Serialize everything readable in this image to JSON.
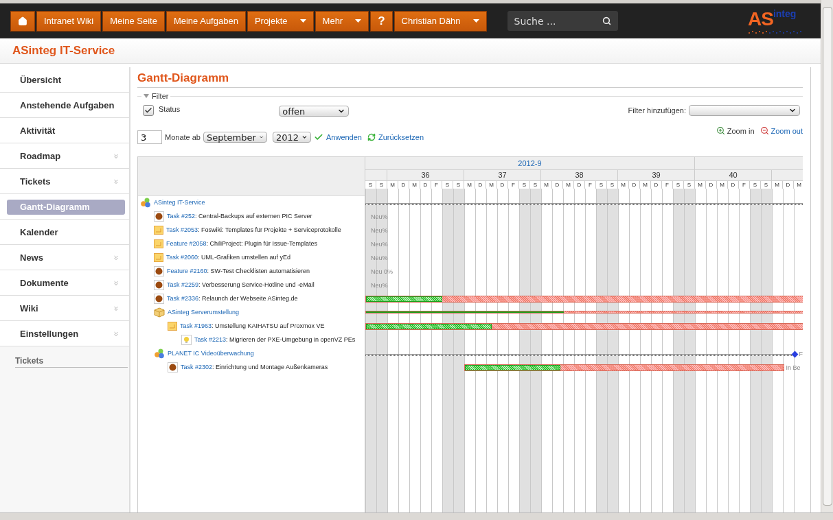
{
  "top_menu": [
    {
      "kind": "home"
    },
    {
      "kind": "item",
      "label": "Intranet Wiki",
      "dropdown": false
    },
    {
      "kind": "item",
      "label": "Meine Seite",
      "dropdown": false
    },
    {
      "kind": "item",
      "label": "Meine Aufgaben",
      "dropdown": false
    },
    {
      "kind": "item",
      "label": "Projekte",
      "dropdown": true
    },
    {
      "kind": "item",
      "label": "Mehr",
      "dropdown": true
    },
    {
      "kind": "help",
      "label": "?",
      "dropdown": false
    },
    {
      "kind": "item",
      "label": "Christian Dähn",
      "dropdown": true
    }
  ],
  "search": {
    "placeholder": "Suche ..."
  },
  "logo": {
    "main": "AS",
    "sup": "integ"
  },
  "project_title": "ASinteg IT-Service",
  "sidebar": {
    "items": [
      {
        "label": "Übersicht",
        "expandable": false,
        "selected": false
      },
      {
        "label": "Anstehende Aufgaben",
        "expandable": false,
        "selected": false
      },
      {
        "label": "Aktivität",
        "expandable": false,
        "selected": false
      },
      {
        "label": "Roadmap",
        "expandable": true,
        "selected": false
      },
      {
        "label": "Tickets",
        "expandable": true,
        "selected": false
      },
      {
        "label": "Gantt-Diagramm",
        "expandable": false,
        "selected": true
      },
      {
        "label": "Kalender",
        "expandable": false,
        "selected": false
      },
      {
        "label": "News",
        "expandable": true,
        "selected": false
      },
      {
        "label": "Dokumente",
        "expandable": true,
        "selected": false
      },
      {
        "label": "Wiki",
        "expandable": true,
        "selected": false
      },
      {
        "label": "Einstellungen",
        "expandable": true,
        "selected": false
      }
    ],
    "section_title": "Tickets"
  },
  "page_title": "Gantt-Diagramm",
  "filter": {
    "legend": "Filter",
    "expanded": true,
    "status": {
      "label": "Status",
      "checked": true,
      "value": "offen"
    },
    "add_label": "Filter hinzufügen:"
  },
  "options": {
    "months": "3",
    "months_label": "Monate ab",
    "month": "September",
    "year": "2012",
    "apply": "Anwenden",
    "reset": "Zurücksetzen",
    "zoom_in": {
      "label": "Zoom in",
      "disabled": true
    },
    "zoom_out": {
      "label": "Zoom out",
      "disabled": false
    }
  },
  "gantt": {
    "months": [
      "2012-9"
    ],
    "lead_days": [
      {
        "label": "S",
        "weekend": true
      },
      {
        "label": "S",
        "weekend": true
      }
    ],
    "weeks": [
      {
        "label": "36",
        "days": [
          {
            "label": "M",
            "weekend": false
          },
          {
            "label": "D",
            "weekend": false
          },
          {
            "label": "M",
            "weekend": false
          },
          {
            "label": "D",
            "weekend": false
          },
          {
            "label": "F",
            "weekend": false
          },
          {
            "label": "S",
            "weekend": true
          },
          {
            "label": "S",
            "weekend": true
          }
        ]
      },
      {
        "label": "37",
        "days": [
          {
            "label": "M",
            "weekend": false
          },
          {
            "label": "D",
            "weekend": false
          },
          {
            "label": "M",
            "weekend": false
          },
          {
            "label": "D",
            "weekend": false
          },
          {
            "label": "F",
            "weekend": false
          },
          {
            "label": "S",
            "weekend": true
          },
          {
            "label": "S",
            "weekend": true
          }
        ]
      },
      {
        "label": "38",
        "days": [
          {
            "label": "M",
            "weekend": false
          },
          {
            "label": "D",
            "weekend": false
          },
          {
            "label": "M",
            "weekend": false
          },
          {
            "label": "D",
            "weekend": false
          },
          {
            "label": "F",
            "weekend": false
          },
          {
            "label": "S",
            "weekend": true
          },
          {
            "label": "S",
            "weekend": true
          }
        ]
      },
      {
        "label": "39",
        "days": [
          {
            "label": "M",
            "weekend": false
          },
          {
            "label": "D",
            "weekend": false
          },
          {
            "label": "M",
            "weekend": false
          },
          {
            "label": "D",
            "weekend": false
          },
          {
            "label": "F",
            "weekend": false
          },
          {
            "label": "S",
            "weekend": true
          },
          {
            "label": "S",
            "weekend": true
          }
        ]
      },
      {
        "label": "40",
        "days": [
          {
            "label": "M",
            "weekend": false
          },
          {
            "label": "D",
            "weekend": false
          },
          {
            "label": "M",
            "weekend": false
          },
          {
            "label": "D",
            "weekend": false
          },
          {
            "label": "F",
            "weekend": false
          },
          {
            "label": "S",
            "weekend": true
          },
          {
            "label": "S",
            "weekend": true
          }
        ]
      },
      {
        "days": [
          {
            "label": "M",
            "weekend": false
          },
          {
            "label": "D",
            "weekend": false
          },
          {
            "label": "M",
            "weekend": false
          }
        ]
      }
    ],
    "rows": [
      {
        "kind": "project",
        "name": "ASinteg IT-Service",
        "children": [
          {
            "kind": "dot",
            "link": "Task #252",
            "subject": ": Central-Backups auf externen PIC Server",
            "status_label": "Neu%"
          },
          {
            "kind": "note",
            "link": "Task #2053",
            "subject": ": Foswiki: Templates für Projekte + Serviceprotokolle",
            "status_label": "Neu%"
          },
          {
            "kind": "note",
            "link": "Feature #2058",
            "subject": ": ChiliProject: Plugin für Issue-Templates",
            "status_label": "Neu%"
          },
          {
            "kind": "note",
            "link": "Task #2060",
            "subject": ": UML-Grafiken umstellen auf yEd",
            "status_label": "Neu%"
          },
          {
            "kind": "dot",
            "link": "Feature #2160",
            "subject": ": SW-Test Checklisten automatisieren",
            "status_label": "Neu 0%"
          },
          {
            "kind": "dot",
            "link": "Task #2259",
            "subject": ": Verbesserung Service-Hotline und -eMail",
            "status_label": "Neu%"
          },
          {
            "kind": "dot",
            "link": "Task #2336",
            "subject": ": Relaunch der Webseite ASinteg.de",
            "level": 0.17
          },
          {
            "kind": "version",
            "name": "ASinteg Serverumstellung",
            "level": 0.44,
            "children": [
              {
                "kind": "note",
                "link": "Task #1963",
                "subject": ": Umstellung KAIHATSU auf Proxmox VE",
                "level": 0.28,
                "children": [
                  {
                    "kind": "bulb",
                    "link": "Task #2213",
                    "subject": ": Migrieren der PXE-Umgebung in openVZ PEs"
                  }
                ]
              }
            ]
          },
          {
            "kind": "project",
            "name": "PLANET IC Videoüberwachung",
            "status_label": "F",
            "children": [
              {
                "kind": "dot",
                "link": "Task #2302",
                "subject": ": Einrichtung und Montage Außenkameras",
                "level": 0.3,
                "status_label": "In Be"
              }
            ]
          }
        ]
      }
    ]
  }
}
